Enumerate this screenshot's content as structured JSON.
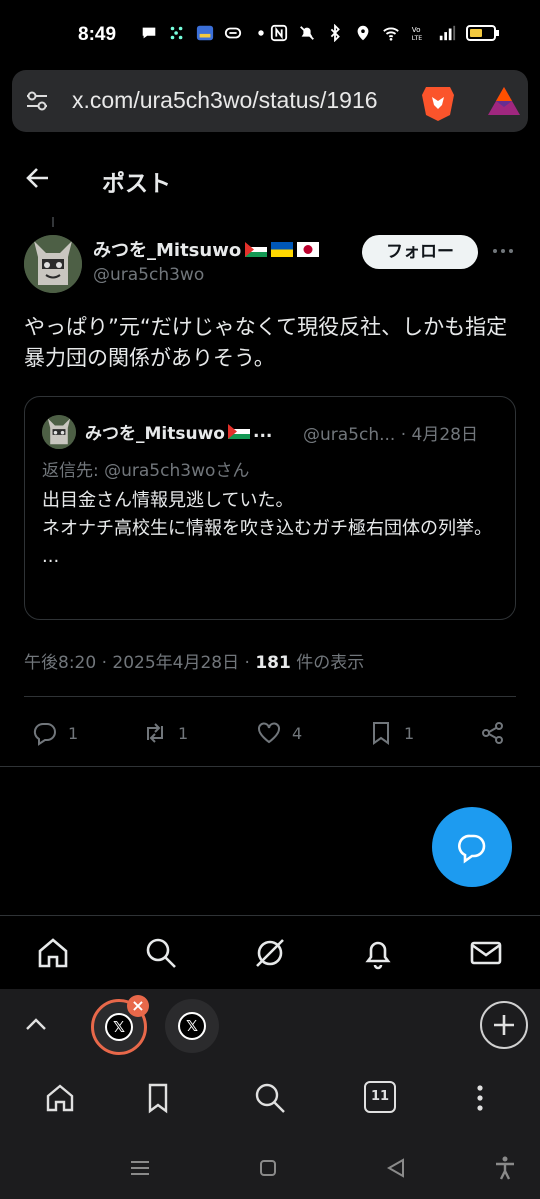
{
  "status_bar": {
    "time": "8:49",
    "right_icons": [
      "nfc-icon",
      "mute-icon",
      "bluetooth-icon",
      "location-icon",
      "wifi-icon",
      "volte-icon",
      "signal-icon",
      "battery-icon"
    ]
  },
  "url_bar": {
    "url": "x.com/ura5ch3wo/status/1916"
  },
  "header": {
    "title": "ポスト"
  },
  "post": {
    "author_name": "みつを_Mitsuwo",
    "author_handle": "@ura5ch3wo",
    "follow_label": "フォロー",
    "text": "やっぱり”元“だけじゃなくて現役反社、しかも指定暴力団の関係がありそう。",
    "quote": {
      "author_name": "みつを_Mitsuwo",
      "name_ellipsis": "...",
      "handle_date": "@ura5ch... · 4月28日",
      "reply_to": "返信先: @ura5ch3woさん",
      "body_line1": "出目金さん情報見逃していた。",
      "body_line2": "ネオナチ高校生に情報を吹き込むガチ極右団体の列挙。",
      "body_line3": "..."
    },
    "meta_time": "午後8:20 · 2025年4月28日 · ",
    "meta_views": "181",
    "meta_views_label": " 件の表示",
    "actions": {
      "replies": "1",
      "reposts": "1",
      "likes": "4",
      "bookmarks": "1"
    }
  },
  "colors": {
    "accent": "#1d9bf0",
    "tab_ring": "#e8684a"
  },
  "browser": {
    "tab_count": "11",
    "tab_icon_label": "𝕏"
  }
}
